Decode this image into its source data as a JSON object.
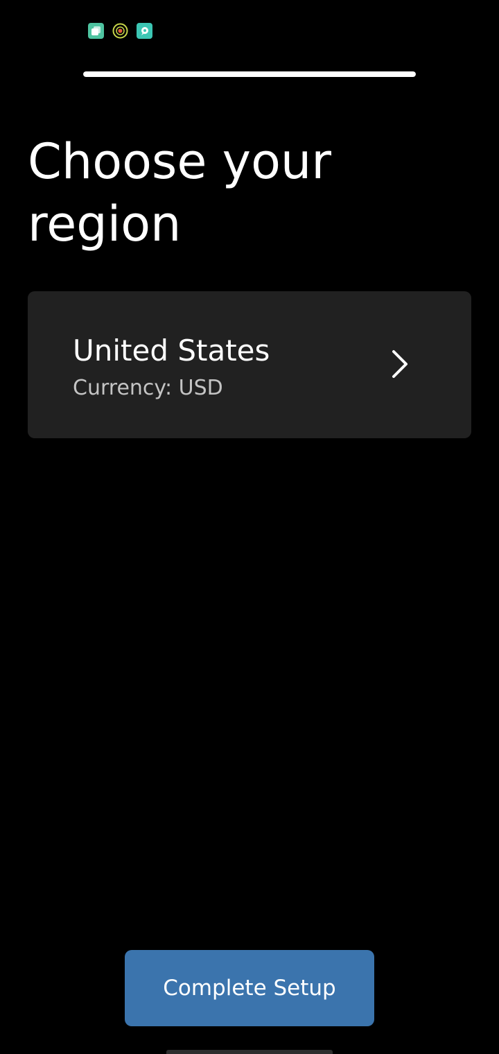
{
  "status_bar": {
    "icons": [
      "app-square-icon",
      "target-ring-icon",
      "chat-bubble-icon"
    ],
    "colors": {
      "app_a": "#4ec3a0",
      "app_b_ring": "#c8d64a",
      "app_b_dot": "#e25a3a",
      "app_c": "#3cc6b4"
    }
  },
  "progress": {
    "value": 1.0,
    "fill_color": "#ffffff"
  },
  "header": {
    "title": "Choose your region"
  },
  "region_card": {
    "name": "United States",
    "currency_label": "Currency: USD",
    "icon": "chevron-right-icon",
    "background": "#212121"
  },
  "actions": {
    "complete_label": "Complete Setup",
    "accent": "#3b74ad"
  }
}
